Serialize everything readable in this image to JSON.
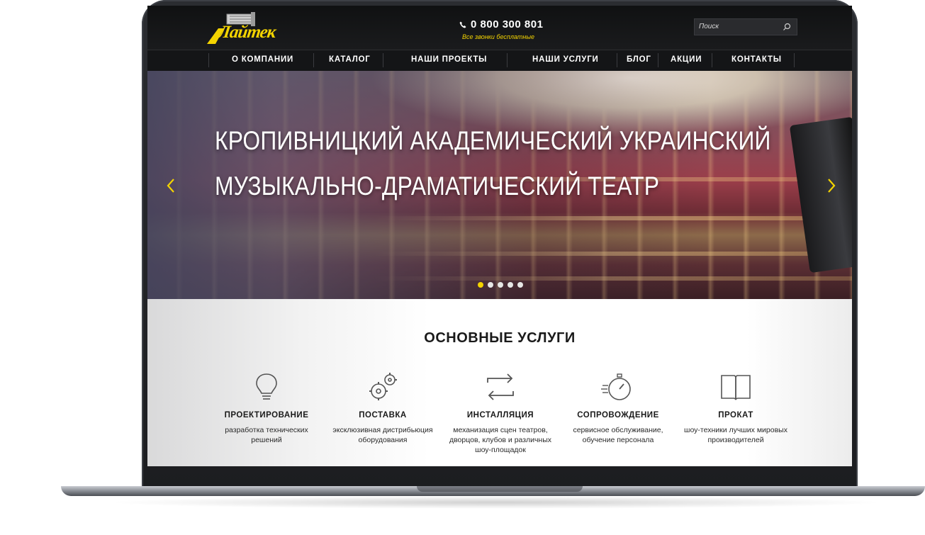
{
  "header": {
    "logo_text": "Лайтек",
    "phone": "0 800 300 801",
    "phone_note": "Все звонки бесплатные",
    "search_placeholder": "Поиск"
  },
  "nav": {
    "items": [
      {
        "label": "О КОМПАНИИ"
      },
      {
        "label": "КАТАЛОГ"
      },
      {
        "label": "НАШИ ПРОЕКТЫ"
      },
      {
        "label": "НАШИ УСЛУГИ"
      },
      {
        "label": "БЛОГ"
      },
      {
        "label": "АКЦИИ"
      },
      {
        "label": "КОНТАКТЫ"
      }
    ]
  },
  "slider": {
    "title_line1": "КРОПИВНИЦКИЙ АКАДЕМИЧЕСКИЙ УКРАИНСКИЙ",
    "title_line2": "МУЗЫКАЛЬНО-ДРАМАТИЧЕСКИЙ ТЕАТР",
    "slide_count": 5,
    "active_slide": 1
  },
  "services": {
    "title": "ОСНОВНЫЕ УСЛУГИ",
    "items": [
      {
        "icon": "lightbulb-icon",
        "title": "ПРОЕКТИРОВАНИЕ",
        "desc": "разработка технических решений"
      },
      {
        "icon": "gears-icon",
        "title": "ПОСТАВКА",
        "desc": "эксклюзивная дистрибьюция оборудования"
      },
      {
        "icon": "exchange-arrows-icon",
        "title": "ИНСТАЛЛЯЦИЯ",
        "desc": "механизация сцен театров, дворцов, клубов и различных шоу-площадок"
      },
      {
        "icon": "stopwatch-icon",
        "title": "СОПРОВОЖДЕНИЕ",
        "desc": "сервисное обслуживание, обучение персонала"
      },
      {
        "icon": "open-book-icon",
        "title": "ПРОКАТ",
        "desc": "шоу-техники лучших мировых производителей"
      }
    ]
  },
  "colors": {
    "accent": "#f4d400",
    "header_bg": "#141517",
    "text_dark": "#1a1a1a"
  }
}
